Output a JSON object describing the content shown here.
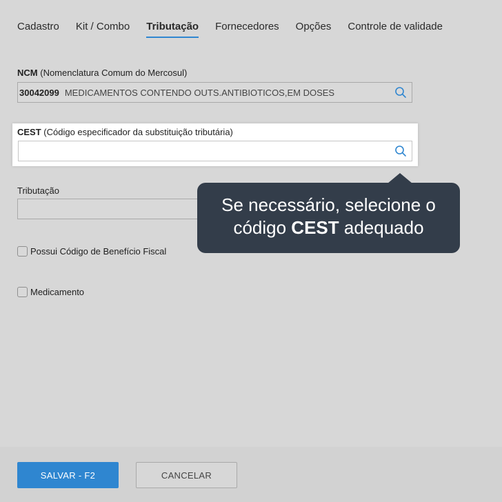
{
  "tabs": [
    {
      "label": "Cadastro",
      "active": false
    },
    {
      "label": "Kit / Combo",
      "active": false
    },
    {
      "label": "Tributação",
      "active": true
    },
    {
      "label": "Fornecedores",
      "active": false
    },
    {
      "label": "Opções",
      "active": false
    },
    {
      "label": "Controle de validade",
      "active": false
    }
  ],
  "ncm": {
    "label_abbr": "NCM",
    "label_full": "(Nomenclatura Comum do Mercosul)",
    "code": "30042099",
    "description": "MEDICAMENTOS CONTENDO OUTS.ANTIBIOTICOS,EM DOSES",
    "icon": "search-icon"
  },
  "cest": {
    "label_abbr": "CEST",
    "label_full": "(Código especificador da substituição tributária)",
    "value": "",
    "icon": "search-icon"
  },
  "tributacao": {
    "label": "Tributação",
    "value": ""
  },
  "checkboxes": {
    "beneficio_fiscal": {
      "label": "Possui Código de Benefício Fiscal",
      "checked": false
    },
    "medicamento": {
      "label": "Medicamento",
      "checked": false
    }
  },
  "tooltip": {
    "line1": "Se necessário, selecione o",
    "line2_before": "código ",
    "line2_bold": "CEST",
    "line2_after": " adequado"
  },
  "footer": {
    "save_label": "SALVAR - F2",
    "cancel_label": "CANCELAR"
  },
  "colors": {
    "accent": "#2f86d0",
    "tooltip_bg": "#333d4a",
    "overlay_bg": "#d7d7d7"
  }
}
